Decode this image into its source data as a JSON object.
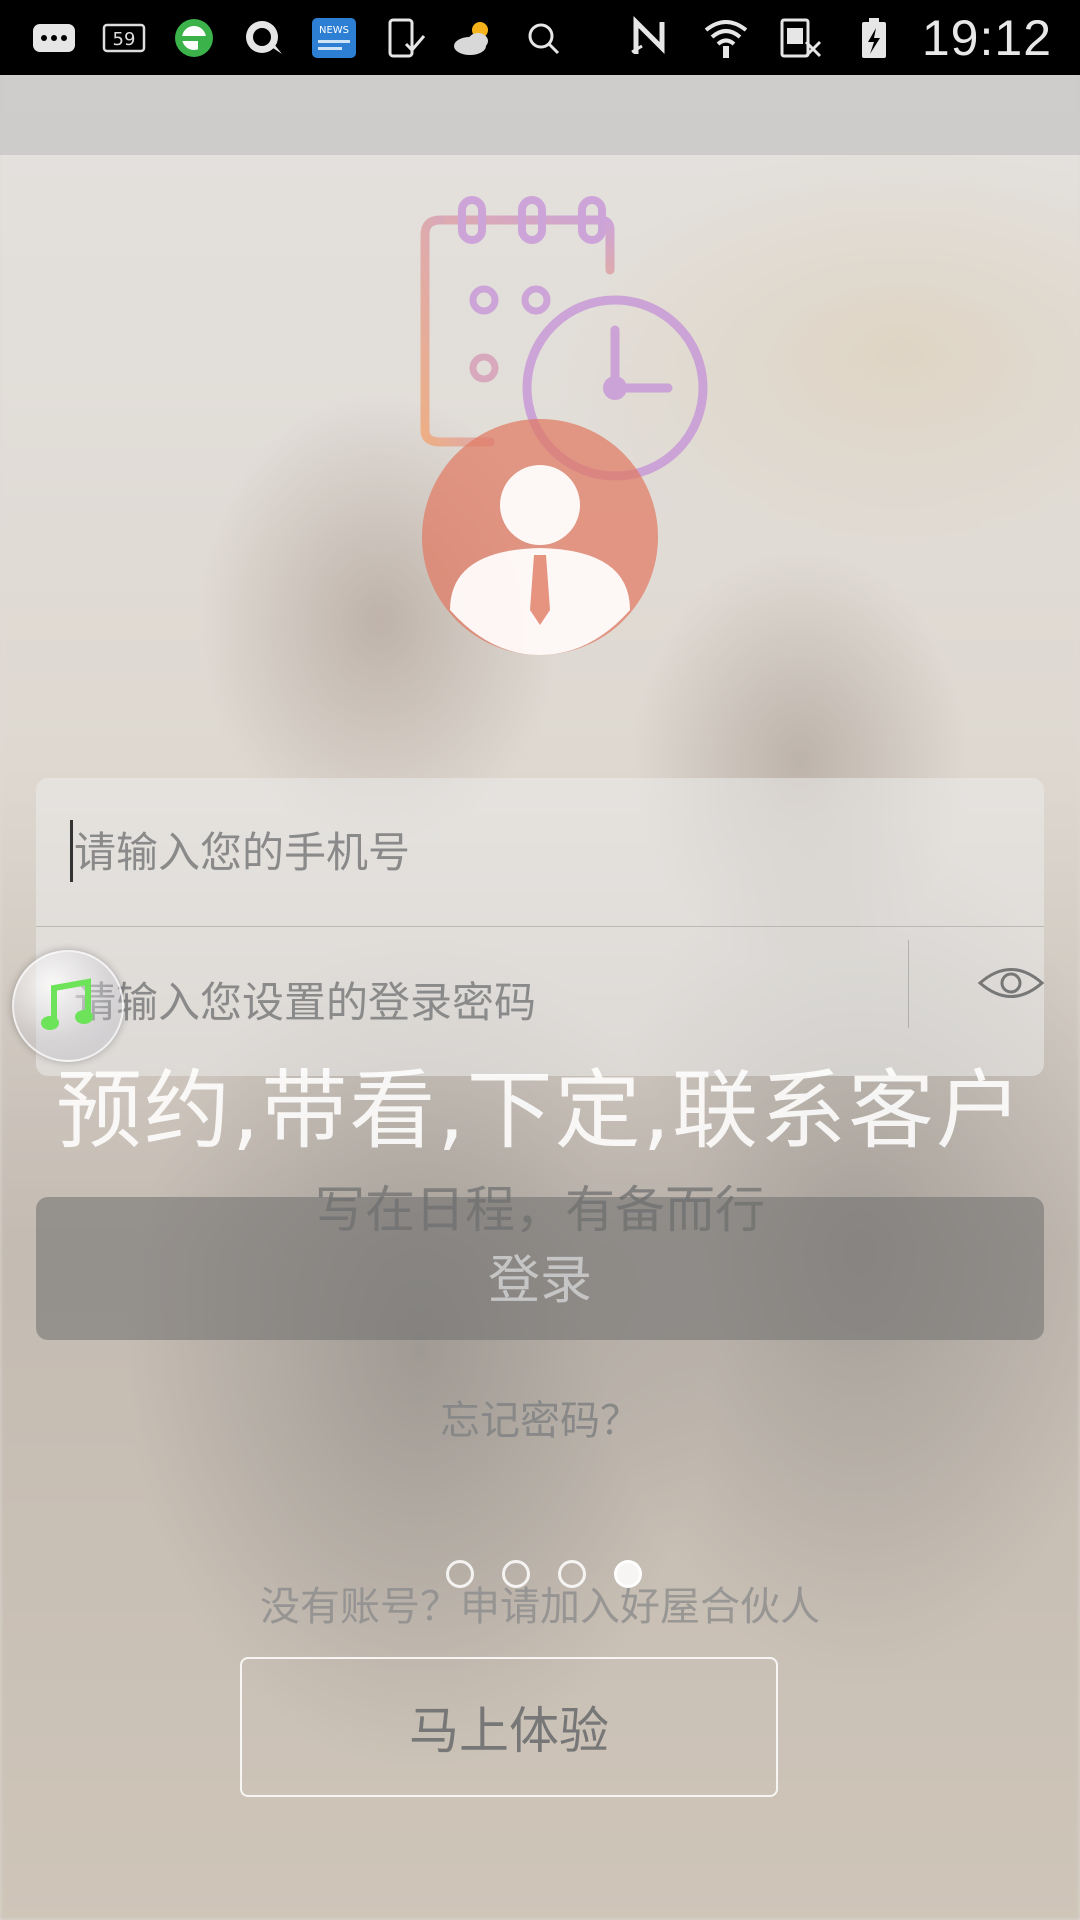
{
  "status_bar": {
    "notification_count": "59",
    "time": "19:12",
    "icons": [
      "chat-icon",
      "badge-59-icon",
      "browser-e-icon",
      "qq-icon",
      "news-icon",
      "phone-download-icon",
      "weather-icon",
      "search-icon",
      "nfc-icon",
      "wifi-icon",
      "no-sim-icon",
      "battery-icon"
    ],
    "news_label": "NEWS"
  },
  "login": {
    "phone_placeholder": "请输入您的手机号",
    "password_placeholder": "请输入您设置的登录密码",
    "login_button": "登录",
    "forgot_password": "忘记密码？",
    "apply_partner": "没有账号？申请加入好屋合伙人",
    "try_now": "马上体验"
  },
  "onboarding": {
    "slogan": "预约,带看,下定,联系客户",
    "subtitle": "写在日程，有备而行",
    "page_count": 4,
    "active_page": 4
  },
  "colors": {
    "calendar_gradient_start": "#f0a878",
    "calendar_gradient_end": "#c99ad8",
    "avatar": "#e07a62"
  }
}
